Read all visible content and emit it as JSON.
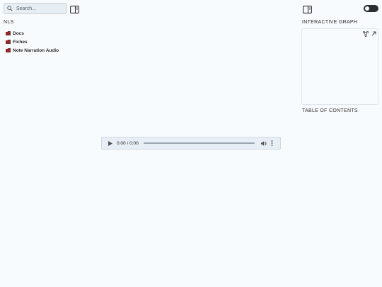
{
  "search": {
    "placeholder": "Search..."
  },
  "site": {
    "title": "NLS"
  },
  "explorer": {
    "folders": [
      {
        "label": "Docs"
      },
      {
        "label": "Fiches"
      },
      {
        "label": "Note Narration Audio"
      }
    ],
    "folder_color": "#8a2c2c"
  },
  "audio": {
    "time": "0:00 / 0:00"
  },
  "graph": {
    "title": "INTERACTIVE GRAPH"
  },
  "toc": {
    "title": "TABLE OF CONTENTS"
  },
  "icons": {
    "search": "search-icon",
    "layout_left": "sidebar-layout-icon",
    "layout_right": "sidebar-layout-icon",
    "theme_toggle": "theme-toggle",
    "folder": "folder-icon",
    "play": "play-icon",
    "volume": "volume-icon",
    "more": "more-vertical-icon",
    "global_graph": "graph-icon",
    "expand": "expand-icon"
  }
}
